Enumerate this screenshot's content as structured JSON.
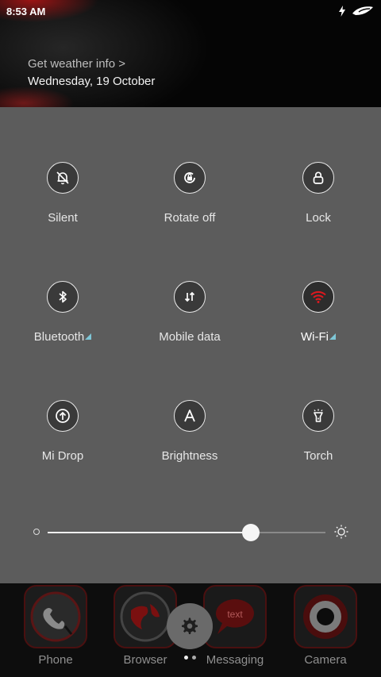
{
  "status": {
    "time": "8:53 AM"
  },
  "header": {
    "weather_link": "Get weather info >",
    "date": "Wednesday, 19 October"
  },
  "tiles": [
    {
      "label": "Silent",
      "icon": "bell-off-icon",
      "state": "off"
    },
    {
      "label": "Rotate off",
      "icon": "rotate-lock-icon",
      "state": "off"
    },
    {
      "label": "Lock",
      "icon": "lock-icon",
      "state": "off"
    },
    {
      "label": "Bluetooth",
      "icon": "bluetooth-icon",
      "state": "off"
    },
    {
      "label": "Mobile data",
      "icon": "mobile-data-icon",
      "state": "off"
    },
    {
      "label": "Wi-Fi",
      "icon": "wifi-icon",
      "state": "on"
    },
    {
      "label": "Mi Drop",
      "icon": "mi-drop-icon",
      "state": "off"
    },
    {
      "label": "Brightness",
      "icon": "auto-brightness-icon",
      "state": "off"
    },
    {
      "label": "Torch",
      "icon": "torch-icon",
      "state": "off"
    }
  ],
  "brightness": {
    "level": 0.73
  },
  "dock": {
    "apps": [
      {
        "label": "Phone"
      },
      {
        "label": "Browser"
      },
      {
        "label": "Messaging",
        "icon_text": "text"
      },
      {
        "label": "Camera"
      }
    ]
  },
  "colors": {
    "panel": "#5c5c5c",
    "accent_red": "#e0181e",
    "arrow": "#7ec6d6"
  }
}
